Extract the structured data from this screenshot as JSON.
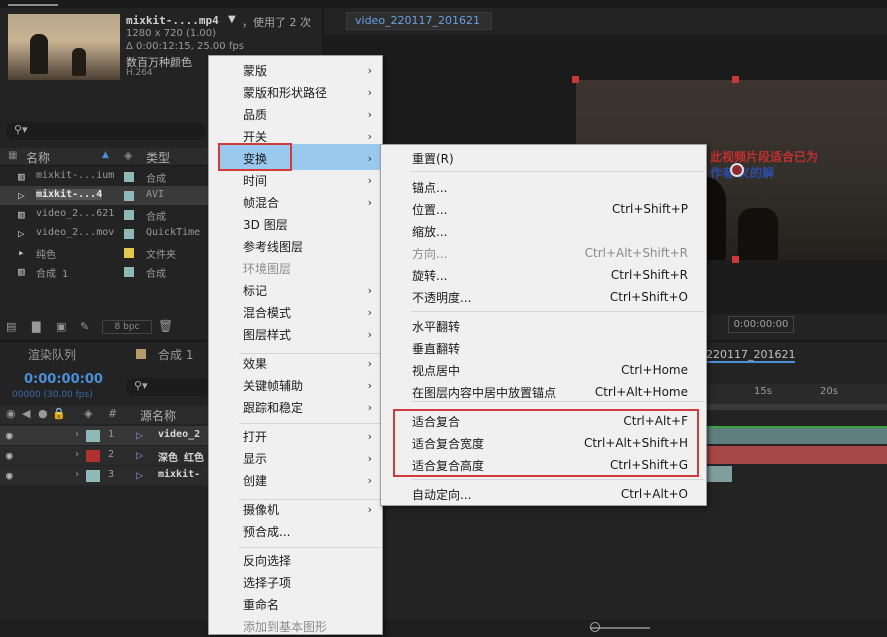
{
  "project": {
    "file_name": "mixkit-....mp4",
    "used": "，使用了 2 次",
    "resolution": "1280 x 720 (1.00)",
    "duration": "Δ 0:00:12:15, 25.00 fps",
    "colors": "数百万种颜色",
    "codec": "H.264",
    "search_placeholder": "",
    "col_name": "名称",
    "col_type": "类型",
    "items": [
      {
        "name": "mixkit-...ium",
        "type": "合成",
        "color": "#8fb8b8"
      },
      {
        "name": "mixkit-...4",
        "type": "AVI",
        "color": "#8fb8b8"
      },
      {
        "name": "video_2...621",
        "type": "合成",
        "color": "#8fb8b8"
      },
      {
        "name": "video_2...mov",
        "type": "QuickTime",
        "color": "#8fb8b8"
      },
      {
        "name": "纯色",
        "type": "文件夹",
        "color": "#e5c84a"
      },
      {
        "name": "合成 1",
        "type": "合成",
        "color": "#8fb8b8"
      }
    ],
    "bpc": "8 bpc"
  },
  "comp_viewer": {
    "tab": "video_220117_201621",
    "timecode": "0:00:00:00",
    "overlay_text_1": "此视频片段适合已为",
    "overlay_text_2": "作者 义的解"
  },
  "timeline": {
    "tab_render": "渲染队列",
    "tab_comp": "合成 1",
    "tab_comp2": "220117_201621",
    "timecode": "0:00:00:00",
    "fps": "00000 (30.00 fps)",
    "col_num": "#",
    "col_source": "源名称",
    "ruler": [
      "15s",
      "20s"
    ],
    "layers": [
      {
        "num": "1",
        "name": "video_2",
        "color": "#8fb8b8"
      },
      {
        "num": "2",
        "name": "深色 红色",
        "color": "#b03030"
      },
      {
        "num": "3",
        "name": "mixkit-",
        "color": "#8fb8b8"
      }
    ]
  },
  "context_menu": {
    "items": [
      {
        "label": "蒙版",
        "arrow": "›"
      },
      {
        "label": "蒙版和形状路径",
        "arrow": "›"
      },
      {
        "label": "品质",
        "arrow": "›"
      },
      {
        "label": "开关",
        "arrow": "›"
      },
      {
        "label": "变换",
        "arrow": "›"
      },
      {
        "label": "时间",
        "arrow": "›"
      },
      {
        "label": "帧混合",
        "arrow": "›"
      },
      {
        "label": "3D 图层",
        "arrow": ""
      },
      {
        "label": "参考线图层",
        "arrow": ""
      },
      {
        "label": "环境图层",
        "arrow": ""
      },
      {
        "label": "标记",
        "arrow": "›"
      },
      {
        "label": "混合模式",
        "arrow": "›"
      },
      {
        "label": "图层样式",
        "arrow": "›"
      },
      {
        "label": "效果",
        "arrow": "›"
      },
      {
        "label": "关键帧辅助",
        "arrow": "›"
      },
      {
        "label": "跟踪和稳定",
        "arrow": "›"
      },
      {
        "label": "打开",
        "arrow": "›"
      },
      {
        "label": "显示",
        "arrow": "›"
      },
      {
        "label": "创建",
        "arrow": "›"
      },
      {
        "label": "摄像机",
        "arrow": "›"
      },
      {
        "label": "预合成...",
        "arrow": ""
      },
      {
        "label": "反向选择",
        "arrow": ""
      },
      {
        "label": "选择子项",
        "arrow": ""
      },
      {
        "label": "重命名",
        "arrow": ""
      },
      {
        "label": "添加到基本图形",
        "arrow": ""
      }
    ]
  },
  "transform_menu": {
    "items": [
      {
        "label": "重置(R)",
        "shortcut": ""
      },
      {
        "label": "锚点...",
        "shortcut": ""
      },
      {
        "label": "位置...",
        "shortcut": "Ctrl+Shift+P"
      },
      {
        "label": "缩放...",
        "shortcut": ""
      },
      {
        "label": "方向...",
        "shortcut": "Ctrl+Alt+Shift+R"
      },
      {
        "label": "旋转...",
        "shortcut": "Ctrl+Shift+R"
      },
      {
        "label": "不透明度...",
        "shortcut": "Ctrl+Shift+O"
      },
      {
        "label": "水平翻转",
        "shortcut": ""
      },
      {
        "label": "垂直翻转",
        "shortcut": ""
      },
      {
        "label": "视点居中",
        "shortcut": "Ctrl+Home"
      },
      {
        "label": "在图层内容中居中放置锚点",
        "shortcut": "Ctrl+Alt+Home"
      },
      {
        "label": "适合复合",
        "shortcut": "Ctrl+Alt+F"
      },
      {
        "label": "适合复合宽度",
        "shortcut": "Ctrl+Alt+Shift+H"
      },
      {
        "label": "适合复合高度",
        "shortcut": "Ctrl+Shift+G"
      },
      {
        "label": "自动定向...",
        "shortcut": "Ctrl+Alt+O"
      }
    ]
  }
}
